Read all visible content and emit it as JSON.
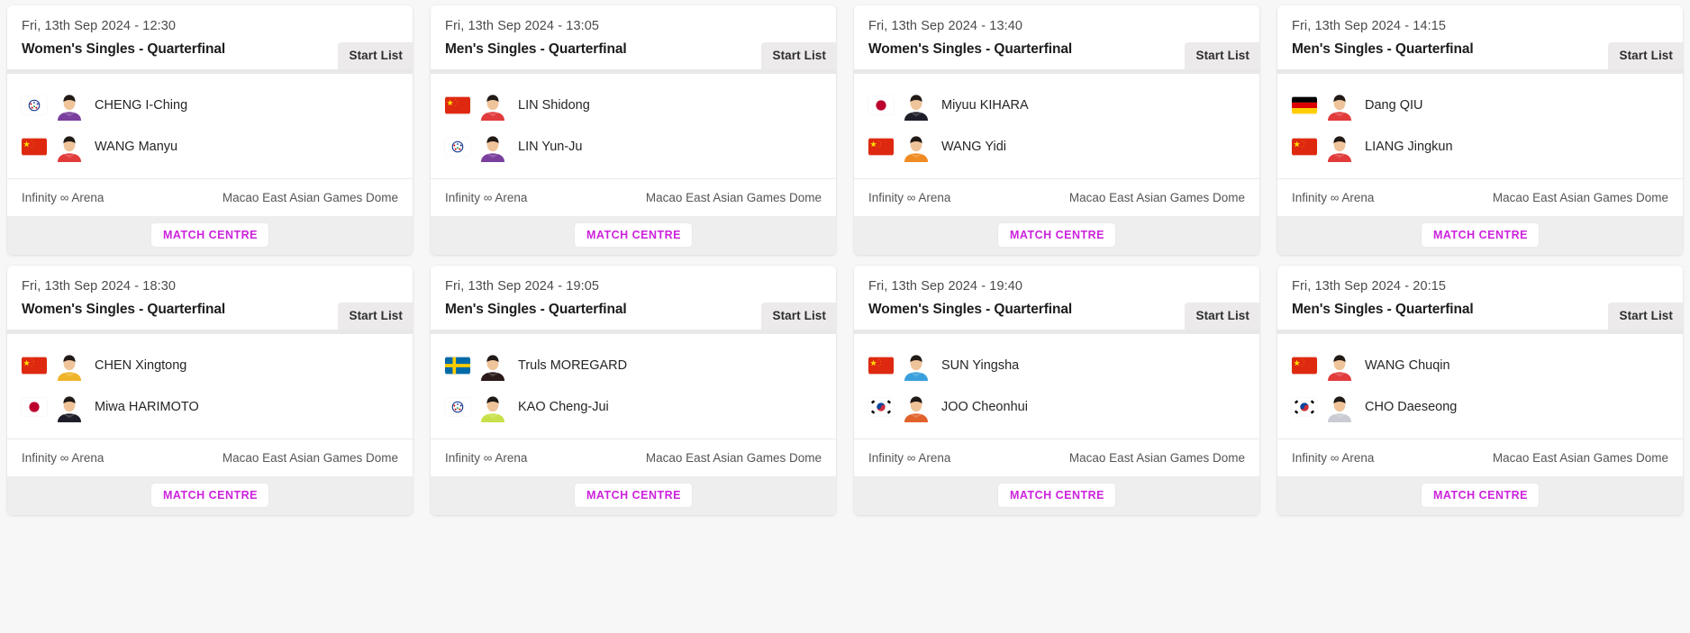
{
  "page": {
    "background": "#f7f7f7",
    "accent_color": "#cc22dd"
  },
  "labels": {
    "start_list": "Start List",
    "match_centre": "MATCH CENTRE"
  },
  "matches": [
    {
      "datetime": "Fri, 13th Sep 2024 - 12:30",
      "title": "Women's Singles - Quarterfinal",
      "start_list": "Start List",
      "match_centre": "MATCH CENTRE",
      "venue_name": "Infinity ∞ Arena",
      "venue_place": "Macao East Asian Games Dome",
      "players": [
        {
          "name": "CHENG I-Ching",
          "flag": "tpe",
          "kit": "#7b3f9e"
        },
        {
          "name": "WANG Manyu",
          "flag": "chn",
          "kit": "#e23b3b"
        }
      ]
    },
    {
      "datetime": "Fri, 13th Sep 2024 - 13:05",
      "title": "Men's Singles - Quarterfinal",
      "start_list": "Start List",
      "match_centre": "MATCH CENTRE",
      "venue_name": "Infinity ∞ Arena",
      "venue_place": "Macao East Asian Games Dome",
      "players": [
        {
          "name": "LIN Shidong",
          "flag": "chn",
          "kit": "#e23b3b"
        },
        {
          "name": "LIN Yun-Ju",
          "flag": "tpe",
          "kit": "#7b3f9e"
        }
      ]
    },
    {
      "datetime": "Fri, 13th Sep 2024 - 13:40",
      "title": "Women's Singles - Quarterfinal",
      "start_list": "Start List",
      "match_centre": "MATCH CENTRE",
      "venue_name": "Infinity ∞ Arena",
      "venue_place": "Macao East Asian Games Dome",
      "players": [
        {
          "name": "Miyuu KIHARA",
          "flag": "jpn",
          "kit": "#1e1e2a"
        },
        {
          "name": "WANG Yidi",
          "flag": "chn",
          "kit": "#f08a22"
        }
      ]
    },
    {
      "datetime": "Fri, 13th Sep 2024 - 14:15",
      "title": "Men's Singles - Quarterfinal",
      "start_list": "Start List",
      "match_centre": "MATCH CENTRE",
      "venue_name": "Infinity ∞ Arena",
      "venue_place": "Macao East Asian Games Dome",
      "players": [
        {
          "name": "Dang QIU",
          "flag": "ger",
          "kit": "#e23b3b"
        },
        {
          "name": "LIANG Jingkun",
          "flag": "chn",
          "kit": "#e23b3b"
        }
      ]
    },
    {
      "datetime": "Fri, 13th Sep 2024 - 18:30",
      "title": "Women's Singles - Quarterfinal",
      "start_list": "Start List",
      "match_centre": "MATCH CENTRE",
      "venue_name": "Infinity ∞ Arena",
      "venue_place": "Macao East Asian Games Dome",
      "players": [
        {
          "name": "CHEN Xingtong",
          "flag": "chn",
          "kit": "#f0b429"
        },
        {
          "name": "Miwa HARIMOTO",
          "flag": "jpn",
          "kit": "#1e1e2a"
        }
      ]
    },
    {
      "datetime": "Fri, 13th Sep 2024 - 19:05",
      "title": "Men's Singles - Quarterfinal",
      "start_list": "Start List",
      "match_centre": "MATCH CENTRE",
      "venue_name": "Infinity ∞ Arena",
      "venue_place": "Macao East Asian Games Dome",
      "players": [
        {
          "name": "Truls MOREGARD",
          "flag": "swe",
          "kit": "#2b1a1a"
        },
        {
          "name": "KAO Cheng-Jui",
          "flag": "tpe",
          "kit": "#c8e04a"
        }
      ]
    },
    {
      "datetime": "Fri, 13th Sep 2024 - 19:40",
      "title": "Women's Singles - Quarterfinal",
      "start_list": "Start List",
      "match_centre": "MATCH CENTRE",
      "venue_name": "Infinity ∞ Arena",
      "venue_place": "Macao East Asian Games Dome",
      "players": [
        {
          "name": "SUN Yingsha",
          "flag": "chn",
          "kit": "#3aa0dd"
        },
        {
          "name": "JOO Cheonhui",
          "flag": "kor",
          "kit": "#e2622b"
        }
      ]
    },
    {
      "datetime": "Fri, 13th Sep 2024 - 20:15",
      "title": "Men's Singles - Quarterfinal",
      "start_list": "Start List",
      "match_centre": "MATCH CENTRE",
      "venue_name": "Infinity ∞ Arena",
      "venue_place": "Macao East Asian Games Dome",
      "players": [
        {
          "name": "WANG Chuqin",
          "flag": "chn",
          "kit": "#e23b3b"
        },
        {
          "name": "CHO Daeseong",
          "flag": "kor",
          "kit": "#c8ccd2"
        }
      ]
    }
  ]
}
